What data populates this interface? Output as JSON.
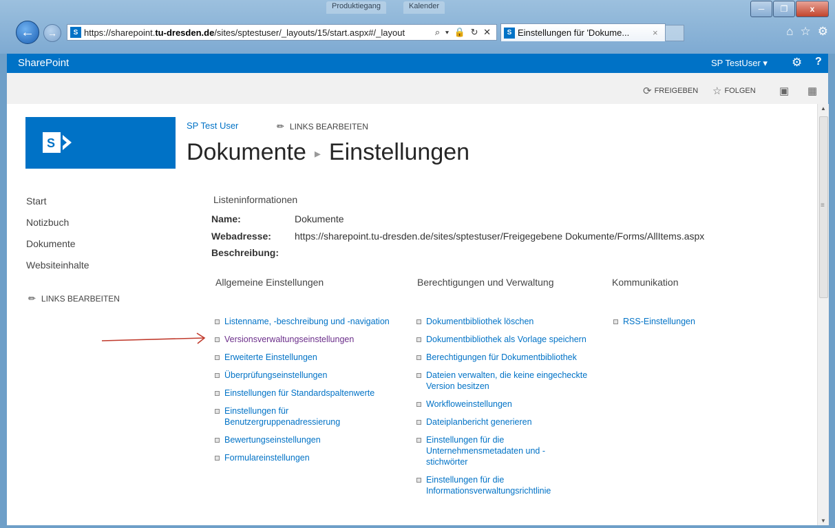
{
  "browser": {
    "url_prefix": "https://sharepoint.",
    "url_domain": "tu-dresden.de",
    "url_suffix": "/sites/sptestuser/_layouts/15/start.aspx#/_layout",
    "tab_title": "Einstellungen für 'Dokume...",
    "tab_close": "×",
    "addr_controls": "⌕ ▾ 🔒 ↻ ✕",
    "bg_tabs": [
      "Produktiegang",
      "Kalender"
    ],
    "window_buttons": [
      "─",
      "❐",
      "x"
    ],
    "icons": [
      "home-icon",
      "star-icon",
      "gear-icon"
    ]
  },
  "suitebar": {
    "brand": "SharePoint",
    "user": "SP TestUser ▾",
    "accent": "#0072c6"
  },
  "ribbon": {
    "share": "FREIGEBEN",
    "follow": "FOLGEN"
  },
  "header": {
    "site_link": "SP Test User",
    "edit_links": "LINKS BEARBEITEN",
    "title_part1": "Dokumente",
    "title_part2": "Einstellungen"
  },
  "nav": {
    "items": [
      "Start",
      "Notizbuch",
      "Dokumente",
      "Websiteinhalte"
    ],
    "edit_links": "LINKS BEARBEITEN"
  },
  "list_info": {
    "heading": "Listeninformationen",
    "name_label": "Name:",
    "name_value": "Dokumente",
    "url_label": "Webadresse:",
    "url_value": "https://sharepoint.tu-dresden.de/sites/sptestuser/Freigegebene Dokumente/Forms/AllItems.aspx",
    "desc_label": "Beschreibung:"
  },
  "sections": {
    "general": {
      "heading": "Allgemeine Einstellungen",
      "links": [
        "Listenname, -beschreibung und -navigation",
        "Versionsverwaltungseinstellungen",
        "Erweiterte Einstellungen",
        "Überprüfungseinstellungen",
        "Einstellungen für Standardspaltenwerte",
        "Einstellungen für Benutzergruppenadressierung",
        "Bewertungseinstellungen",
        "Formulareinstellungen"
      ]
    },
    "permissions": {
      "heading": "Berechtigungen und Verwaltung",
      "links": [
        "Dokumentbibliothek löschen",
        "Dokumentbibliothek als Vorlage speichern",
        "Berechtigungen für Dokumentbibliothek",
        "Dateien verwalten, die keine eingecheckte Version besitzen",
        "Workfloweinstellungen",
        "Dateiplanbericht generieren",
        "Einstellungen für die Unternehmensmetadaten und -stichwörter",
        "Einstellungen für die Informationsverwaltungsrichtlinie"
      ]
    },
    "communication": {
      "heading": "Kommunikation",
      "links": [
        "RSS-Einstellungen"
      ]
    }
  }
}
